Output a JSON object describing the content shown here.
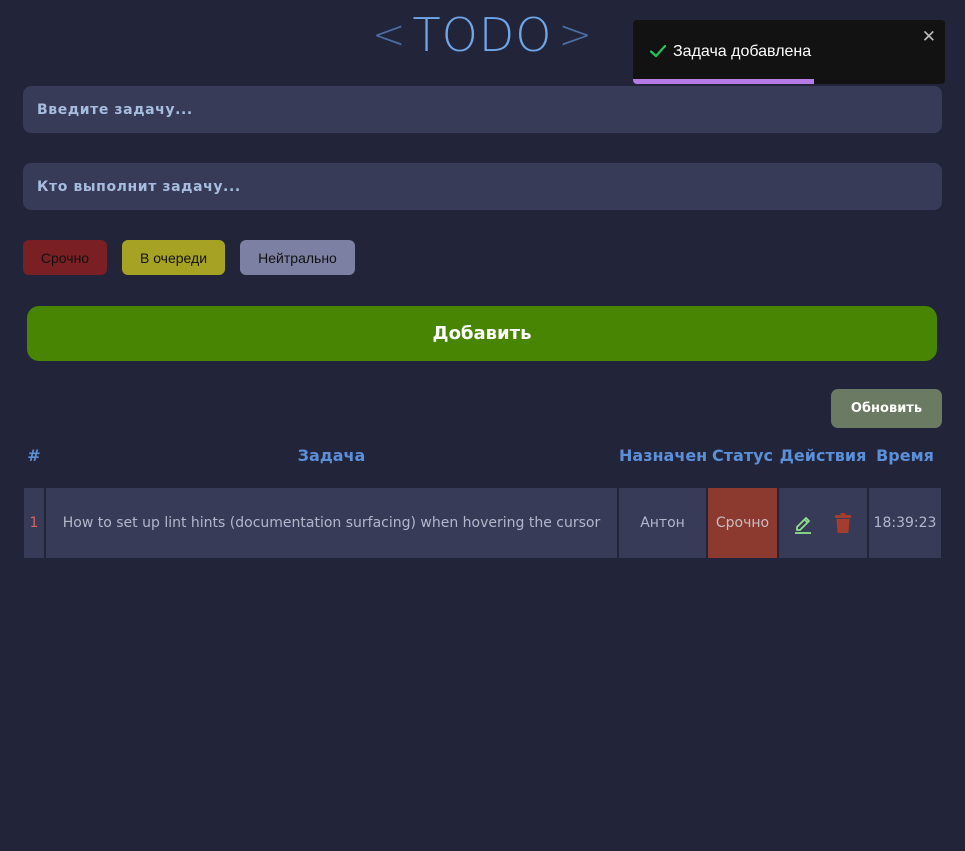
{
  "header": {
    "left_bracket": "<",
    "title": "TODO",
    "right_bracket": ">"
  },
  "form": {
    "task_placeholder": "Введите задачу...",
    "assignee_placeholder": "Кто выполнит задачу...",
    "priorities": [
      {
        "label": "Срочно",
        "color": "#7a1f24"
      },
      {
        "label": "В очереди",
        "color": "#a6a224"
      },
      {
        "label": "Нейтрально",
        "color": "#7c80a2"
      }
    ],
    "add_label": "Добавить"
  },
  "toolbar": {
    "refresh_label": "Обновить"
  },
  "table": {
    "headers": [
      "#",
      "Задача",
      "Назначен",
      "Статус",
      "Действия",
      "Время"
    ],
    "rows": [
      {
        "num": "1",
        "task": "How to set up lint hints (documentation surfacing) when hovering the cursor",
        "assignee": "Антон",
        "status": "Срочно",
        "time": "18:39:23",
        "actions": [
          "pencil-icon",
          "trash-icon"
        ]
      }
    ]
  },
  "toast": {
    "message": "Задача добавлена",
    "close": "✕",
    "icon": "check-icon",
    "progress": 0.58
  },
  "colors": {
    "background": "#22243a",
    "accent_blue": "#5b8fd8",
    "add_green": "#478502",
    "status_urgent": "#8c3a30",
    "toast_progress": "#b57ce8"
  }
}
